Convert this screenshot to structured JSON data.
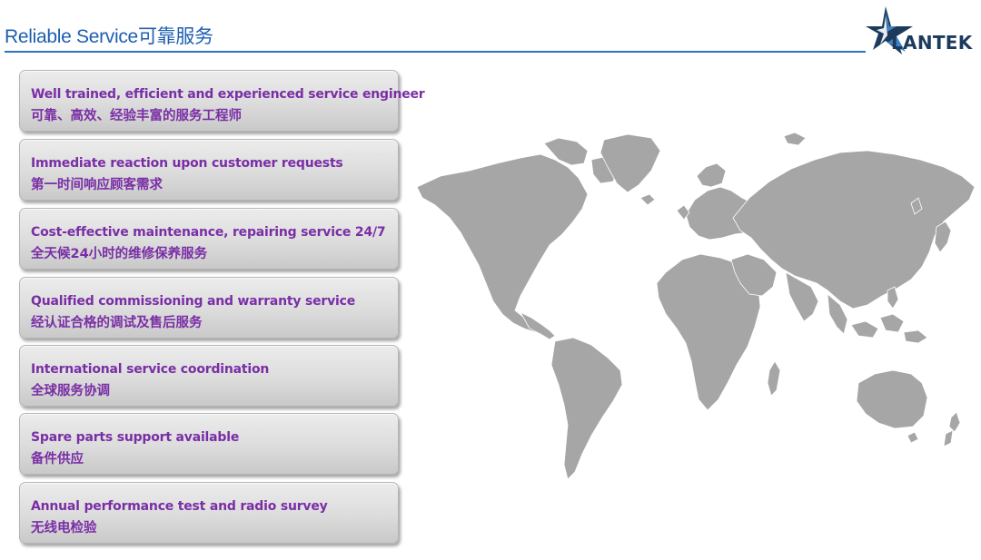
{
  "header": {
    "title": "Reliable Service可靠服务",
    "logo_text": "LANTEK"
  },
  "services": [
    {
      "en": "Well trained, efficient and experienced service engineer",
      "zh": "可靠、高效、经验丰富的服务工程师"
    },
    {
      "en": "Immediate reaction upon customer requests",
      "zh": "第一时间响应顾客需求"
    },
    {
      "en": "Cost-effective maintenance, repairing service 24/7",
      "zh": "全天候24小时的维修保养服务"
    },
    {
      "en": "Qualified commissioning and warranty service",
      "zh": "经认证合格的调试及售后服务"
    },
    {
      "en": "International service coordination",
      "zh": "全球服务协调"
    },
    {
      "en": "Spare parts support available",
      "zh": "备件供应"
    },
    {
      "en": "Annual performance test and radio survey",
      "zh": "无线电检验"
    }
  ],
  "colors": {
    "title": "#1f5fb0",
    "card_text": "#7a2ea6",
    "map": "#a6a6a6",
    "logo_dark": "#1b3a5c",
    "logo_blue": "#3e82c8"
  }
}
